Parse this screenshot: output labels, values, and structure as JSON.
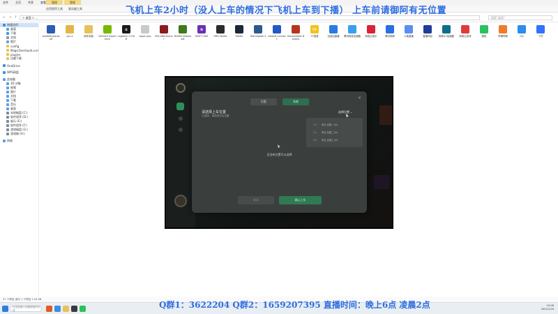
{
  "window": {
    "tabs": [
      "文件",
      "主页",
      "共享",
      "查看"
    ],
    "context_tabs": [
      "管理",
      "管理"
    ],
    "ribbon": [
      "应用程序工具",
      "驱动器工具"
    ],
    "address": "> 桌面 > ...",
    "search_placeholder": "搜索\"桌面\"",
    "nav_back": "←",
    "nav_forward": "→",
    "nav_up": "↑"
  },
  "overlay": {
    "top_text": "飞机上车2小时（没人上车的情况下飞机上车到下播）   上车前请御阿有无位置",
    "bottom_text": "Q群1：3622204 Q群2：1659207395   直播时间：晚上6点 凌晨2点"
  },
  "sidebar": {
    "items": [
      {
        "label": "快速访问",
        "color": "#3b8fe0",
        "selected": true,
        "indent": false
      },
      {
        "label": "桌面",
        "color": "#4aa3e8",
        "indent": true
      },
      {
        "label": "下载",
        "color": "#3d9be0",
        "indent": true
      },
      {
        "label": "文档",
        "color": "#8a97a6",
        "indent": true
      },
      {
        "label": "图片",
        "color": "#5ba6de",
        "indent": true
      },
      {
        "label": "config",
        "color": "#e8c15a",
        "indent": true
      },
      {
        "label": "MagicOverlaudi.o.elo",
        "color": "#e8c15a",
        "indent": true
      },
      {
        "label": "plugins",
        "color": "#e8c15a",
        "indent": true
      },
      {
        "label": "迅雷下载",
        "color": "#e8c15a",
        "indent": true
      },
      {
        "label": "",
        "gap": true
      },
      {
        "label": "OneDrive",
        "color": "#3b8fe0",
        "indent": false
      },
      {
        "label": "",
        "gap": true
      },
      {
        "label": "WPS网盘",
        "color": "#3b8fe0",
        "indent": false
      },
      {
        "label": "",
        "gap": true
      },
      {
        "label": "此电脑",
        "color": "#5aa0e6",
        "indent": false
      },
      {
        "label": "3D 对象",
        "color": "#5aa0e6",
        "indent": true
      },
      {
        "label": "视频",
        "color": "#5aa0e6",
        "indent": true
      },
      {
        "label": "图片",
        "color": "#5aa0e6",
        "indent": true
      },
      {
        "label": "文档",
        "color": "#5aa0e6",
        "indent": true
      },
      {
        "label": "下载",
        "color": "#5aa0e6",
        "indent": true
      },
      {
        "label": "音乐",
        "color": "#5aa0e6",
        "indent": true
      },
      {
        "label": "桌面",
        "color": "#5aa0e6",
        "indent": true
      },
      {
        "label": "本地磁盘 (C:)",
        "color": "#7b8a99",
        "indent": true
      },
      {
        "label": "软件程序 (D:)",
        "color": "#7b8a99",
        "indent": true
      },
      {
        "label": "娱乐 (E:)",
        "color": "#7b8a99",
        "indent": true
      },
      {
        "label": "软件程序 (F:)",
        "color": "#7b8a99",
        "indent": true
      },
      {
        "label": "游戏磁盘 (G:)",
        "color": "#7b8a99",
        "indent": true
      },
      {
        "label": "游戏磁 (H:)",
        "color": "#7b8a99",
        "indent": true
      },
      {
        "label": "",
        "gap": true
      },
      {
        "label": "网络",
        "color": "#5aa0e6",
        "indent": false
      }
    ]
  },
  "files": [
    {
      "name": "anadelfrozenwolf",
      "color": "#2b5db5",
      "glyph": ""
    },
    {
      "name": "cpu-z",
      "color": "#e2b648",
      "glyph": ""
    },
    {
      "name": "软件安装",
      "color": "#e8c15a",
      "glyph": ""
    },
    {
      "name": "GeForce Experience",
      "color": "#76b900",
      "glyph": ""
    },
    {
      "name": "Logitech G HUB",
      "color": "#1a1a1a",
      "glyph": "G"
    },
    {
      "name": "logo1.png",
      "color": "#c9c9c9",
      "glyph": ""
    },
    {
      "name": "MSI Afterburner",
      "color": "#8a1c1c",
      "glyph": ""
    },
    {
      "name": "NVIDIA Broadcast",
      "color": "#3e7a1a",
      "glyph": ""
    },
    {
      "name": "NZXT CAM",
      "color": "#6b2fb5",
      "glyph": "N"
    },
    {
      "name": "OBS Studio",
      "color": "#2b2b2b",
      "glyph": ""
    },
    {
      "name": "Steam",
      "color": "#1b2838",
      "glyph": ""
    },
    {
      "name": "TeamSpeak 3",
      "color": "#2c5a8f",
      "glyph": ""
    },
    {
      "name": "Ubisoft Connect",
      "color": "#2458c7",
      "glyph": ""
    },
    {
      "name": "Voicemeeter Banana",
      "color": "#b8341e",
      "glyph": ""
    },
    {
      "name": "YY语音",
      "color": "#f0c419",
      "glyph": "YY"
    },
    {
      "name": "迅游加速器",
      "color": "#2b7ae0",
      "glyph": ""
    },
    {
      "name": "腾讯网游加速器",
      "color": "#37a0ef",
      "glyph": ""
    },
    {
      "name": "网易云音乐",
      "color": "#d8233a",
      "glyph": ""
    },
    {
      "name": "腾讯视频",
      "color": "#2a6ee6",
      "glyph": ""
    },
    {
      "name": "斗鱼直播",
      "color": "#5a8ef0",
      "glyph": ""
    },
    {
      "name": "直播伴侣",
      "color": "#1f3d9a",
      "glyph": ""
    },
    {
      "name": "网易UU加速器",
      "color": "#0b6e8a",
      "glyph": ""
    },
    {
      "name": "网易云游戏",
      "color": "#e03a3a",
      "glyph": ""
    },
    {
      "name": "微信",
      "color": "#2ac15f",
      "glyph": ""
    },
    {
      "name": "哔哩哔哩",
      "color": "#f07a2a",
      "glyph": ""
    },
    {
      "name": "QQ",
      "color": "#2d8cf0",
      "glyph": ""
    },
    {
      "name": "飞书",
      "color": "#3370ff",
      "glyph": ""
    }
  ],
  "app": {
    "modal": {
      "tab_left": "别墅",
      "tab_right": "车库",
      "heading": "请选择上车位置",
      "subtitle": "已选择，请选择对应位置",
      "dropdown": "选择位置 ⌄",
      "menu": [
        {
          "k": "1/4",
          "v": "车位-位置一 0/4"
        },
        {
          "k": "2/4",
          "v": "车位-位置二 0/4"
        },
        {
          "k": "3/4",
          "v": "车位-位置三 0/4"
        }
      ],
      "empty_text": "还没有位置可以选择",
      "btn_cancel": "取消",
      "btn_confirm": "确认上车",
      "close": "×"
    }
  },
  "statusbar": {
    "text": "27 个项目     选中 1 个项目  1.54 KB"
  },
  "taskbar": {
    "search_placeholder": "在这里输入你要搜索的内容",
    "time": "19:06",
    "date": "2022/1/16"
  }
}
